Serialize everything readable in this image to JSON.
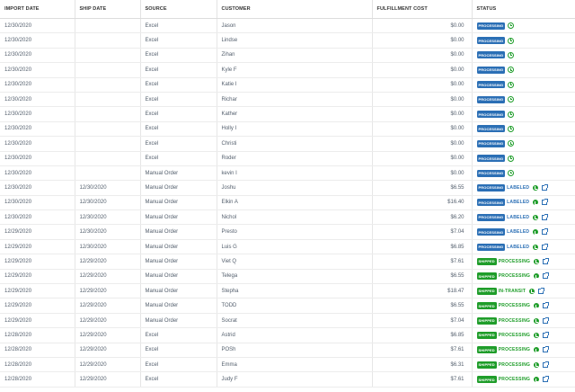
{
  "columns": [
    "IMPORT DATE",
    "SHIP DATE",
    "SOURCE",
    "CUSTOMER",
    "FULFILLMENT COST",
    "STATUS"
  ],
  "rows": [
    {
      "import_date": "12/30/2020",
      "ship_date": "",
      "source": "Excel",
      "customer": "Jason",
      "cost": "$0.00",
      "badge": "PROCESSING",
      "badge_type": "processing",
      "sub": "",
      "sub_type": "",
      "icon": "clock",
      "link": false
    },
    {
      "import_date": "12/30/2020",
      "ship_date": "",
      "source": "Excel",
      "customer": "Lindse",
      "cost": "$0.00",
      "badge": "PROCESSING",
      "badge_type": "processing",
      "sub": "",
      "sub_type": "",
      "icon": "clock",
      "link": false
    },
    {
      "import_date": "12/30/2020",
      "ship_date": "",
      "source": "Excel",
      "customer": "Zihan",
      "cost": "$0.00",
      "badge": "PROCESSING",
      "badge_type": "processing",
      "sub": "",
      "sub_type": "",
      "icon": "clock",
      "link": false
    },
    {
      "import_date": "12/30/2020",
      "ship_date": "",
      "source": "Excel",
      "customer": "Kyle F",
      "cost": "$0.00",
      "badge": "PROCESSING",
      "badge_type": "processing",
      "sub": "",
      "sub_type": "",
      "icon": "clock",
      "link": false
    },
    {
      "import_date": "12/30/2020",
      "ship_date": "",
      "source": "Excel",
      "customer": "Katie I",
      "cost": "$0.00",
      "badge": "PROCESSING",
      "badge_type": "processing",
      "sub": "",
      "sub_type": "",
      "icon": "clock",
      "link": false
    },
    {
      "import_date": "12/30/2020",
      "ship_date": "",
      "source": "Excel",
      "customer": "Richar",
      "cost": "$0.00",
      "badge": "PROCESSING",
      "badge_type": "processing",
      "sub": "",
      "sub_type": "",
      "icon": "clock",
      "link": false
    },
    {
      "import_date": "12/30/2020",
      "ship_date": "",
      "source": "Excel",
      "customer": "Kather",
      "cost": "$0.00",
      "badge": "PROCESSING",
      "badge_type": "processing",
      "sub": "",
      "sub_type": "",
      "icon": "clock",
      "link": false
    },
    {
      "import_date": "12/30/2020",
      "ship_date": "",
      "source": "Excel",
      "customer": "Holly I",
      "cost": "$0.00",
      "badge": "PROCESSING",
      "badge_type": "processing",
      "sub": "",
      "sub_type": "",
      "icon": "clock",
      "link": false
    },
    {
      "import_date": "12/30/2020",
      "ship_date": "",
      "source": "Excel",
      "customer": "Christi",
      "cost": "$0.00",
      "badge": "PROCESSING",
      "badge_type": "processing",
      "sub": "",
      "sub_type": "",
      "icon": "clock",
      "link": false
    },
    {
      "import_date": "12/30/2020",
      "ship_date": "",
      "source": "Excel",
      "customer": "Roder",
      "cost": "$0.00",
      "badge": "PROCESSING",
      "badge_type": "processing",
      "sub": "",
      "sub_type": "",
      "icon": "clock",
      "link": false
    },
    {
      "import_date": "12/30/2020",
      "ship_date": "",
      "source": "Manual Order",
      "customer": "kevin I",
      "cost": "$0.00",
      "badge": "PROCESSING",
      "badge_type": "processing",
      "sub": "",
      "sub_type": "",
      "icon": "clock",
      "link": false
    },
    {
      "import_date": "12/30/2020",
      "ship_date": "12/30/2020",
      "source": "Manual Order",
      "customer": "Joshu",
      "cost": "$6.55",
      "badge": "PROCESSING",
      "badge_type": "processing",
      "sub": "LABELED",
      "sub_type": "blue",
      "icon": "phone",
      "link": true
    },
    {
      "import_date": "12/30/2020",
      "ship_date": "12/30/2020",
      "source": "Manual Order",
      "customer": "Elkin A",
      "cost": "$16.40",
      "badge": "PROCESSING",
      "badge_type": "processing",
      "sub": "LABELED",
      "sub_type": "blue",
      "icon": "phone",
      "link": true
    },
    {
      "import_date": "12/30/2020",
      "ship_date": "12/30/2020",
      "source": "Manual Order",
      "customer": "Nichol",
      "cost": "$6.20",
      "badge": "PROCESSING",
      "badge_type": "processing",
      "sub": "LABELED",
      "sub_type": "blue",
      "icon": "phone",
      "link": true
    },
    {
      "import_date": "12/29/2020",
      "ship_date": "12/30/2020",
      "source": "Manual Order",
      "customer": "Presto",
      "cost": "$7.04",
      "badge": "PROCESSING",
      "badge_type": "processing",
      "sub": "LABELED",
      "sub_type": "blue",
      "icon": "phone",
      "link": true
    },
    {
      "import_date": "12/29/2020",
      "ship_date": "12/30/2020",
      "source": "Manual Order",
      "customer": "Luis G",
      "cost": "$6.85",
      "badge": "PROCESSING",
      "badge_type": "processing",
      "sub": "LABELED",
      "sub_type": "blue",
      "icon": "phone",
      "link": true
    },
    {
      "import_date": "12/29/2020",
      "ship_date": "12/29/2020",
      "source": "Manual Order",
      "customer": "Viet Q",
      "cost": "$7.61",
      "badge": "SHIPPED",
      "badge_type": "shipped",
      "sub": "PROCESSING",
      "sub_type": "green",
      "icon": "phone",
      "link": true
    },
    {
      "import_date": "12/29/2020",
      "ship_date": "12/29/2020",
      "source": "Manual Order",
      "customer": "Telega",
      "cost": "$6.55",
      "badge": "SHIPPED",
      "badge_type": "shipped",
      "sub": "PROCESSING",
      "sub_type": "green",
      "icon": "phone",
      "link": true
    },
    {
      "import_date": "12/29/2020",
      "ship_date": "12/29/2020",
      "source": "Manual Order",
      "customer": "Stepha",
      "cost": "$18.47",
      "badge": "SHIPPED",
      "badge_type": "shipped",
      "sub": "IN-TRANSIT",
      "sub_type": "green",
      "icon": "phone",
      "link": true
    },
    {
      "import_date": "12/29/2020",
      "ship_date": "12/29/2020",
      "source": "Manual Order",
      "customer": "TODD",
      "cost": "$6.55",
      "badge": "SHIPPED",
      "badge_type": "shipped",
      "sub": "PROCESSING",
      "sub_type": "green",
      "icon": "phone",
      "link": true
    },
    {
      "import_date": "12/29/2020",
      "ship_date": "12/29/2020",
      "source": "Manual Order",
      "customer": "Socrat",
      "cost": "$7.04",
      "badge": "SHIPPED",
      "badge_type": "shipped",
      "sub": "PROCESSING",
      "sub_type": "green",
      "icon": "phone",
      "link": true
    },
    {
      "import_date": "12/28/2020",
      "ship_date": "12/29/2020",
      "source": "Excel",
      "customer": "Astrid",
      "cost": "$6.85",
      "badge": "SHIPPED",
      "badge_type": "shipped",
      "sub": "PROCESSING",
      "sub_type": "green",
      "icon": "phone",
      "link": true
    },
    {
      "import_date": "12/28/2020",
      "ship_date": "12/29/2020",
      "source": "Excel",
      "customer": "POSh",
      "cost": "$7.61",
      "badge": "SHIPPED",
      "badge_type": "shipped",
      "sub": "PROCESSING",
      "sub_type": "green",
      "icon": "phone",
      "link": true
    },
    {
      "import_date": "12/28/2020",
      "ship_date": "12/29/2020",
      "source": "Excel",
      "customer": "Emma",
      "cost": "$6.31",
      "badge": "SHIPPED",
      "badge_type": "shipped",
      "sub": "PROCESSING",
      "sub_type": "green",
      "icon": "phone",
      "link": true
    },
    {
      "import_date": "12/28/2020",
      "ship_date": "12/29/2020",
      "source": "Excel",
      "customer": "Judy F",
      "cost": "$7.61",
      "badge": "SHIPPED",
      "badge_type": "shipped",
      "sub": "PROCESSING",
      "sub_type": "green",
      "icon": "phone",
      "link": true
    }
  ],
  "colors": {
    "processing_badge": "#2b6fb5",
    "shipped_badge": "#1f9d2a",
    "labeled_text": "#2b6fb5",
    "shipped_sub_text": "#1f9d2a"
  },
  "icons": {
    "clock": "clock-icon",
    "phone": "phone-icon",
    "link": "external-link-icon"
  }
}
